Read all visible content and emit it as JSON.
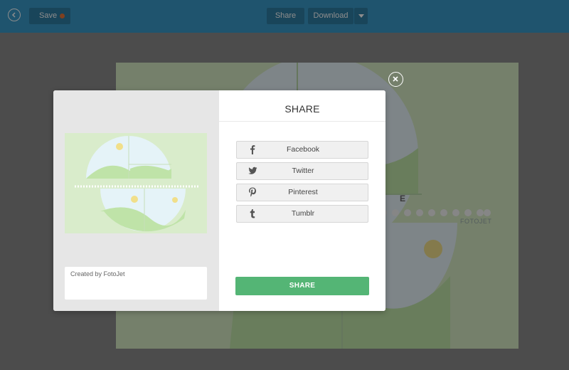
{
  "toolbar": {
    "save_label": "Save",
    "share_label": "Share",
    "download_label": "Download"
  },
  "canvas_bg": {
    "watermark": "FOTOJET",
    "letter": "E"
  },
  "modal": {
    "title": "SHARE",
    "caption_placeholder": "Created by FotoJet",
    "options": [
      {
        "label": "Facebook",
        "icon": "facebook-icon"
      },
      {
        "label": "Twitter",
        "icon": "twitter-icon"
      },
      {
        "label": "Pinterest",
        "icon": "pinterest-icon"
      },
      {
        "label": "Tumblr",
        "icon": "tumblr-icon"
      }
    ],
    "share_button": "SHARE"
  },
  "colors": {
    "topbar": "#3a9ac9",
    "share_green": "#54b575",
    "canvas_green": "#d5e9c4"
  }
}
